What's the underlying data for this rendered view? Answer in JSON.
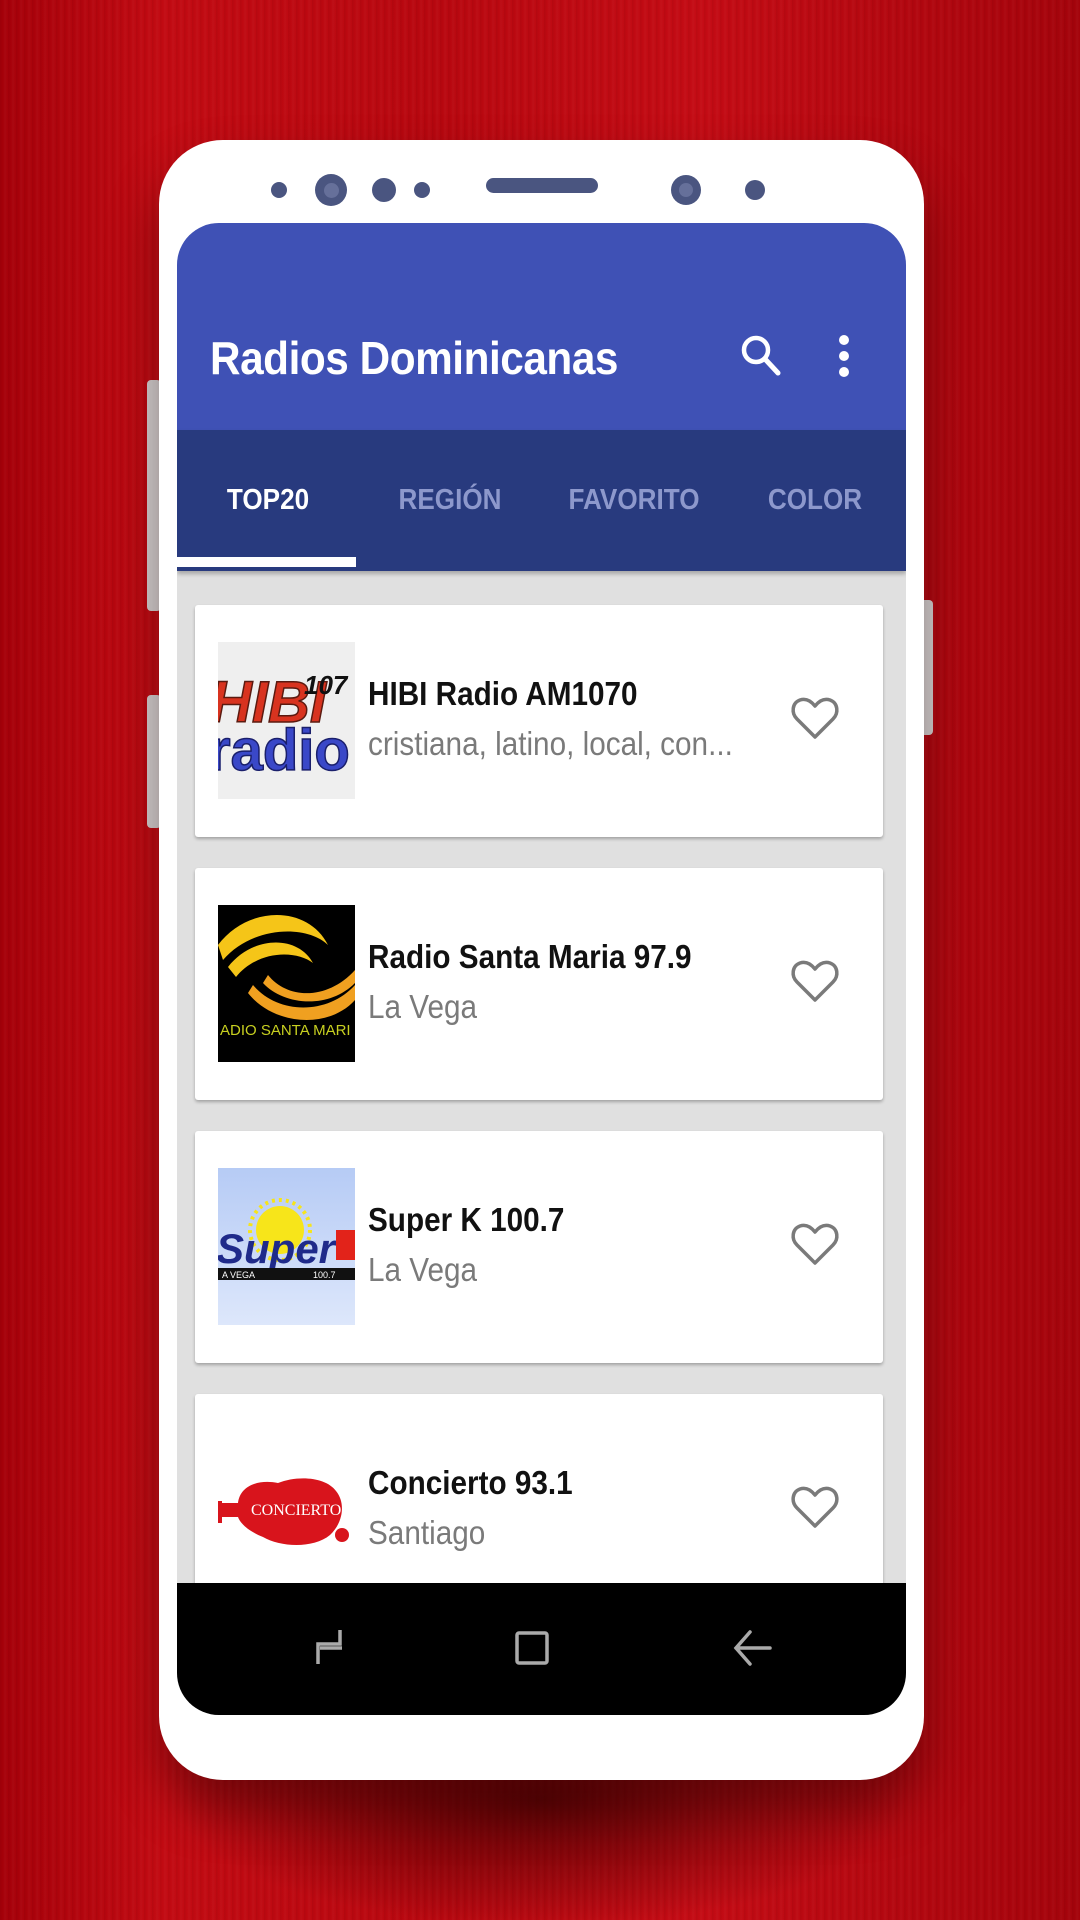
{
  "app": {
    "title": "Radios Dominicanas",
    "colors": {
      "primary": "#3f51b5",
      "primary_dark": "#283a7e",
      "accent_indicator": "#ffffff",
      "background": "#e0e0e0",
      "frame_background": "#c20a12"
    }
  },
  "toolbar": {
    "search_icon": "search-icon",
    "overflow_icon": "more-vert-icon"
  },
  "tabs": [
    {
      "label": "TOP20",
      "active": true
    },
    {
      "label": "REGIÓN",
      "active": false
    },
    {
      "label": "FAVORITO",
      "active": false
    },
    {
      "label": "COLOR",
      "active": false
    }
  ],
  "stations": [
    {
      "name": "HIBI Radio AM1070",
      "subtitle": "cristiana, latino, local, con...",
      "logo_text": "HIBI radio",
      "favorite": false
    },
    {
      "name": "Radio Santa Maria 97.9",
      "subtitle": "La Vega",
      "logo_text": "RADIO SANTA MARIA",
      "favorite": false
    },
    {
      "name": "Super K 100.7",
      "subtitle": "La Vega",
      "logo_text": "Super K",
      "favorite": false
    },
    {
      "name": "Concierto 93.1",
      "subtitle": "Santiago",
      "logo_text": "CONCIERTO",
      "favorite": false
    }
  ],
  "navbar": {
    "recents_icon": "recents-icon",
    "home_icon": "home-icon",
    "back_icon": "back-icon"
  }
}
